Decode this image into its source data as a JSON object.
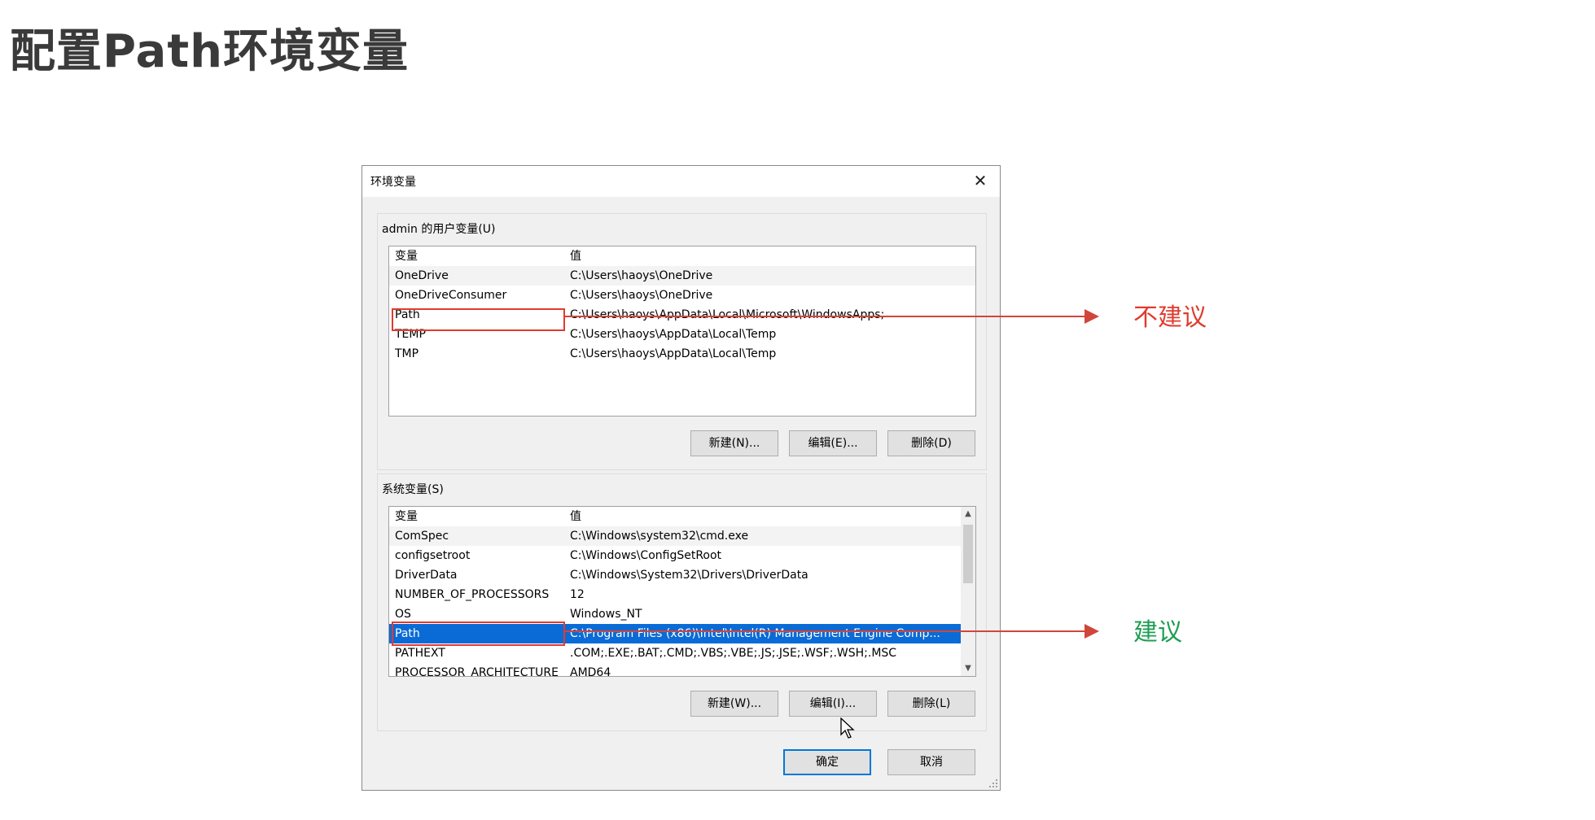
{
  "slide": {
    "title": "配置Path环境变量"
  },
  "dialog": {
    "title": "环境变量",
    "close_glyph": "✕"
  },
  "user_vars": {
    "label": "admin 的用户变量(U)",
    "header": [
      "变量",
      "值"
    ],
    "rows": [
      [
        "OneDrive",
        "C:\\Users\\haoys\\OneDrive"
      ],
      [
        "OneDriveConsumer",
        "C:\\Users\\haoys\\OneDrive"
      ],
      [
        "Path",
        "C:\\Users\\haoys\\AppData\\Local\\Microsoft\\WindowsApps;"
      ],
      [
        "TEMP",
        "C:\\Users\\haoys\\AppData\\Local\\Temp"
      ],
      [
        "TMP",
        "C:\\Users\\haoys\\AppData\\Local\\Temp"
      ]
    ],
    "buttons": {
      "new": "新建(N)...",
      "edit": "编辑(E)...",
      "delete": "删除(D)"
    }
  },
  "system_vars": {
    "label": "系统变量(S)",
    "header": [
      "变量",
      "值"
    ],
    "rows": [
      [
        "ComSpec",
        "C:\\Windows\\system32\\cmd.exe"
      ],
      [
        "configsetroot",
        "C:\\Windows\\ConfigSetRoot"
      ],
      [
        "DriverData",
        "C:\\Windows\\System32\\Drivers\\DriverData"
      ],
      [
        "NUMBER_OF_PROCESSORS",
        "12"
      ],
      [
        "OS",
        "Windows_NT"
      ],
      [
        "Path",
        "C:\\Program Files (x86)\\Intel\\Intel(R) Management Engine Comp..."
      ],
      [
        "PATHEXT",
        ".COM;.EXE;.BAT;.CMD;.VBS;.VBE;.JS;.JSE;.WSF;.WSH;.MSC"
      ],
      [
        "PROCESSOR_ARCHITECTURE",
        "AMD64"
      ]
    ],
    "selected_index": 5,
    "buttons": {
      "new": "新建(W)...",
      "edit": "编辑(I)...",
      "delete": "删除(L)"
    }
  },
  "footer": {
    "ok": "确定",
    "cancel": "取消"
  },
  "annotations": {
    "not_recommended": {
      "text": "不建议",
      "color": "#e03b2f"
    },
    "recommended": {
      "text": "建议",
      "color": "#1e9e54"
    }
  },
  "colors": {
    "selection": "#0a6bd6",
    "highlight_box": "#e03b2f",
    "arrow": "#d0463a"
  }
}
